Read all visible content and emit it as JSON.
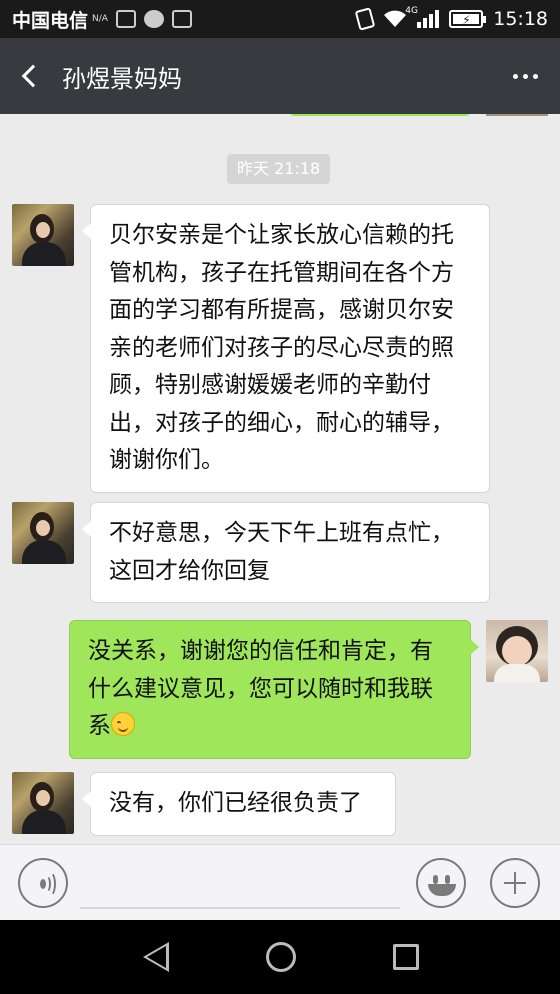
{
  "status_bar": {
    "carrier": "中国电信",
    "network_label": "N/A",
    "signal_type": "4G",
    "time": "15:18"
  },
  "header": {
    "title": "孙煜景妈妈"
  },
  "chat": {
    "timestamp": "昨天 21:18",
    "messages": [
      {
        "side": "left",
        "text": "贝尔安亲是个让家长放心信赖的托管机构，孩子在托管期间在各个方面的学习都有所提高，感谢贝尔安亲的老师们对孩子的尽心尽责的照顾，特别感谢媛媛老师的辛勤付出，对孩子的细心，耐心的辅导，谢谢你们。"
      },
      {
        "side": "left",
        "text": "不好意思，今天下午上班有点忙，这回才给你回复"
      },
      {
        "side": "right",
        "text": "没关系，谢谢您的信任和肯定，有什么建议意见，您可以随时和我联系"
      },
      {
        "side": "left",
        "text": "没有，你们已经很负责了"
      }
    ]
  },
  "icons": {
    "back": "chevron-left-icon",
    "more": "more-dots-icon",
    "voice": "voice-input-icon",
    "emoji": "emoji-icon",
    "plus": "plus-icon",
    "smile_emoji": "smiling-face-emoji",
    "nav_back": "nav-back-icon",
    "nav_home": "nav-home-icon",
    "nav_recent": "nav-recent-icon"
  },
  "colors": {
    "title_bar": "#393a3f",
    "chat_background": "#ebebeb",
    "sent_bubble": "#9fe65a",
    "received_bubble": "#ffffff"
  }
}
